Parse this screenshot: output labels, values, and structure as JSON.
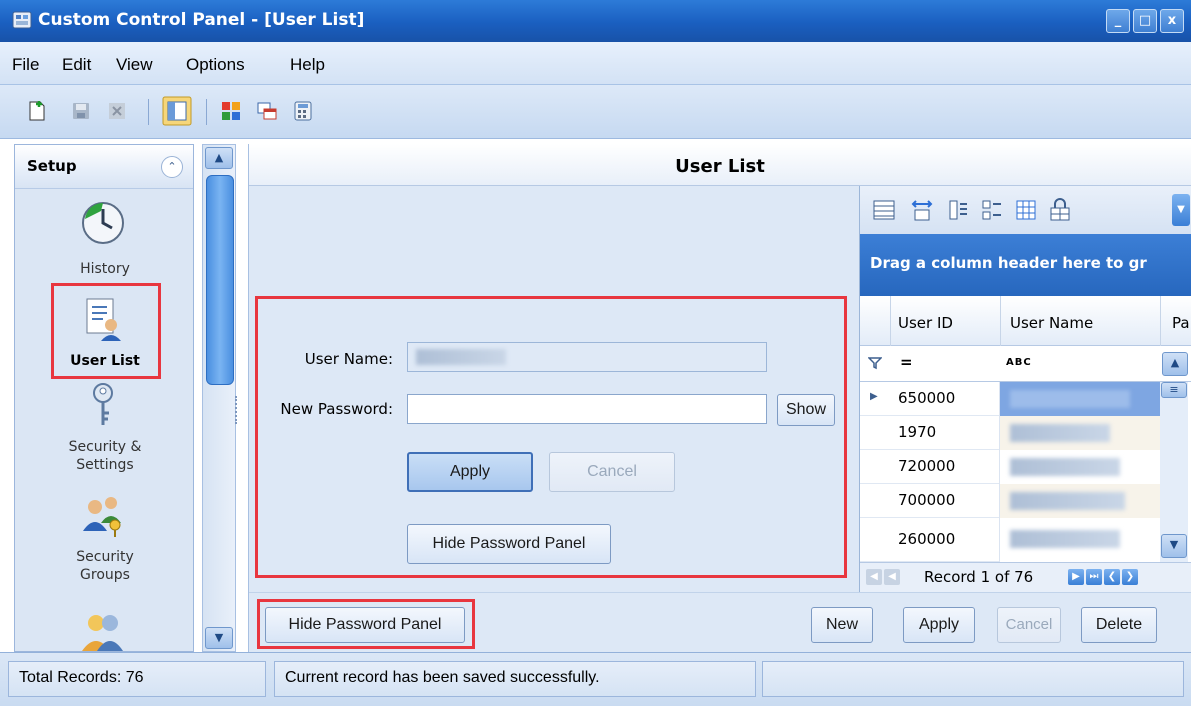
{
  "window": {
    "title": "Custom Control Panel - [User List]",
    "controls": [
      "_",
      "□",
      "x"
    ]
  },
  "menu": {
    "items": [
      "File",
      "Edit",
      "View",
      "Options",
      "Help"
    ]
  },
  "toolbar": {
    "icons": [
      "new-icon",
      "save-icon",
      "delete-icon",
      "layout-icon",
      "color-grid-icon",
      "windows-icon",
      "calculator-icon"
    ]
  },
  "nav": {
    "header": "Setup",
    "items": [
      {
        "label": "History",
        "icon": "clock-icon"
      },
      {
        "label": "User List",
        "icon": "user-list-icon",
        "selected": true
      },
      {
        "label": "Security & Settings",
        "icon": "key-icon"
      },
      {
        "label": "Security Groups",
        "icon": "users-key-icon"
      }
    ],
    "security_line1": "Security &",
    "security_line2": "Settings",
    "groups_line1": "Security",
    "groups_line2": "Groups"
  },
  "main": {
    "title": "User List",
    "form": {
      "user_name_label": "User Name:",
      "new_password_label": "New Password:",
      "new_password_value": "",
      "show_label": "Show",
      "apply_label": "Apply",
      "cancel_label": "Cancel",
      "hide_password_label": "Hide Password Panel"
    },
    "bottom": {
      "hide_password_label": "Hide Password Panel",
      "new_label": "New",
      "apply_label": "Apply",
      "cancel_label": "Cancel",
      "delete_label": "Delete"
    }
  },
  "grid": {
    "group_panel_text": "Drag a column header here to gr",
    "columns": [
      "User ID",
      "User Name",
      "Pa"
    ],
    "filter_eq": "=",
    "filter_abc": "ABC",
    "rows": [
      {
        "user_id": "650000"
      },
      {
        "user_id": "1970"
      },
      {
        "user_id": "720000"
      },
      {
        "user_id": "700000"
      },
      {
        "user_id": "260000"
      }
    ],
    "record_text": "Record 1 of 76"
  },
  "status": {
    "total_records": "Total Records: 76",
    "message": "Current record has been saved successfully.",
    "extra": ""
  },
  "colors": {
    "highlight_red": "#e8363f",
    "title_blue": "#1a5fc0",
    "group_panel_blue": "#2d6fc6"
  }
}
